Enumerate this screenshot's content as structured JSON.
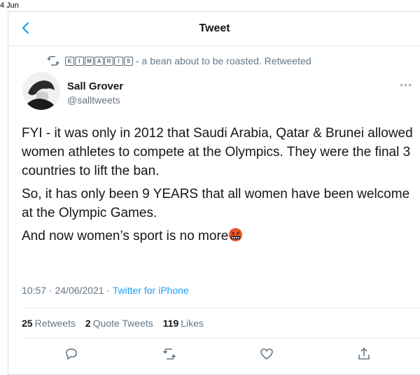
{
  "status_bar": {
    "date": "4 Jun"
  },
  "header": {
    "title": "Tweet"
  },
  "retweet_context": {
    "badge_letters": [
      "K",
      "I",
      "M",
      "A",
      "R",
      "I",
      "S"
    ],
    "text": "- a bean about to be roasted. Retweeted"
  },
  "tweet": {
    "author_name": "Sall Grover",
    "author_handle": "@salltweets",
    "paragraphs": [
      "FYI - it was only in 2012 that Saudi Arabia, Qatar & Brunei allowed women athletes to compete at the Olympics. They were the final 3 countries to lift the ban.",
      "So, it has only been 9 YEARS that all women have been welcome at the Olympic Games.",
      "And now women’s sport is no more"
    ],
    "emoji": "angry-swearing-face",
    "timestamp": "10:57 · 24/06/2021 ·",
    "source": "Twitter for iPhone"
  },
  "stats": {
    "retweets_count": "25",
    "retweets_label": "Retweets",
    "quote_count": "2",
    "quote_label": "Quote Tweets",
    "likes_count": "119",
    "likes_label": "Likes"
  },
  "icons": {
    "back": "chevron-left-icon",
    "reply": "reply-icon",
    "retweet": "retweet-icon",
    "like": "heart-icon",
    "share": "share-icon",
    "more": "more-icon"
  },
  "colors": {
    "accent": "#1da1f2",
    "secondary_text": "#657786",
    "primary_text": "#14171a"
  }
}
